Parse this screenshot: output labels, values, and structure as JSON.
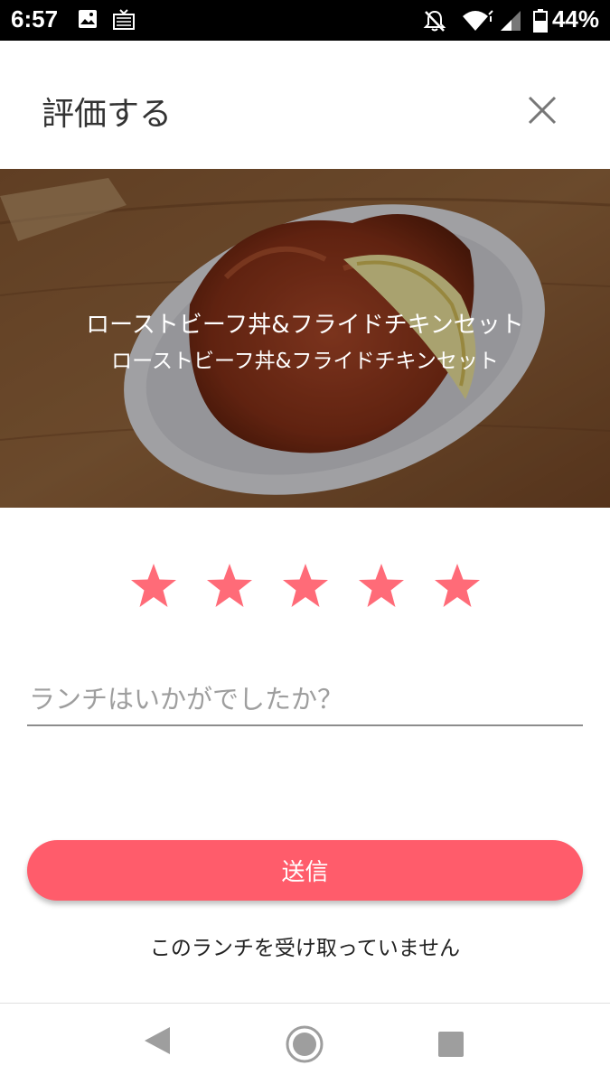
{
  "status_bar": {
    "time": "6:57",
    "battery_percent": "44%",
    "icons": [
      "image-icon",
      "cast-icon",
      "notifications-off-icon",
      "wifi-icon",
      "cellular-signal-icon",
      "battery-icon"
    ]
  },
  "header": {
    "title": "評価する",
    "close_icon": "close-icon"
  },
  "hero": {
    "title_main": "ローストビーフ丼&フライドチキンセット",
    "title_sub": "ローストビーフ丼&フライドチキンセット"
  },
  "rating": {
    "value": 5,
    "max": 5,
    "star_color": "#ff6b78"
  },
  "comment": {
    "value": "",
    "placeholder": "ランチはいかがでしたか？"
  },
  "actions": {
    "submit_label": "送信",
    "not_received_label": "このランチを受け取っていません"
  },
  "colors": {
    "accent": "#ff5c6b",
    "status_bar": "#000000"
  },
  "nav_bar": {
    "icons": [
      "back-icon",
      "home-icon",
      "recents-icon"
    ]
  }
}
